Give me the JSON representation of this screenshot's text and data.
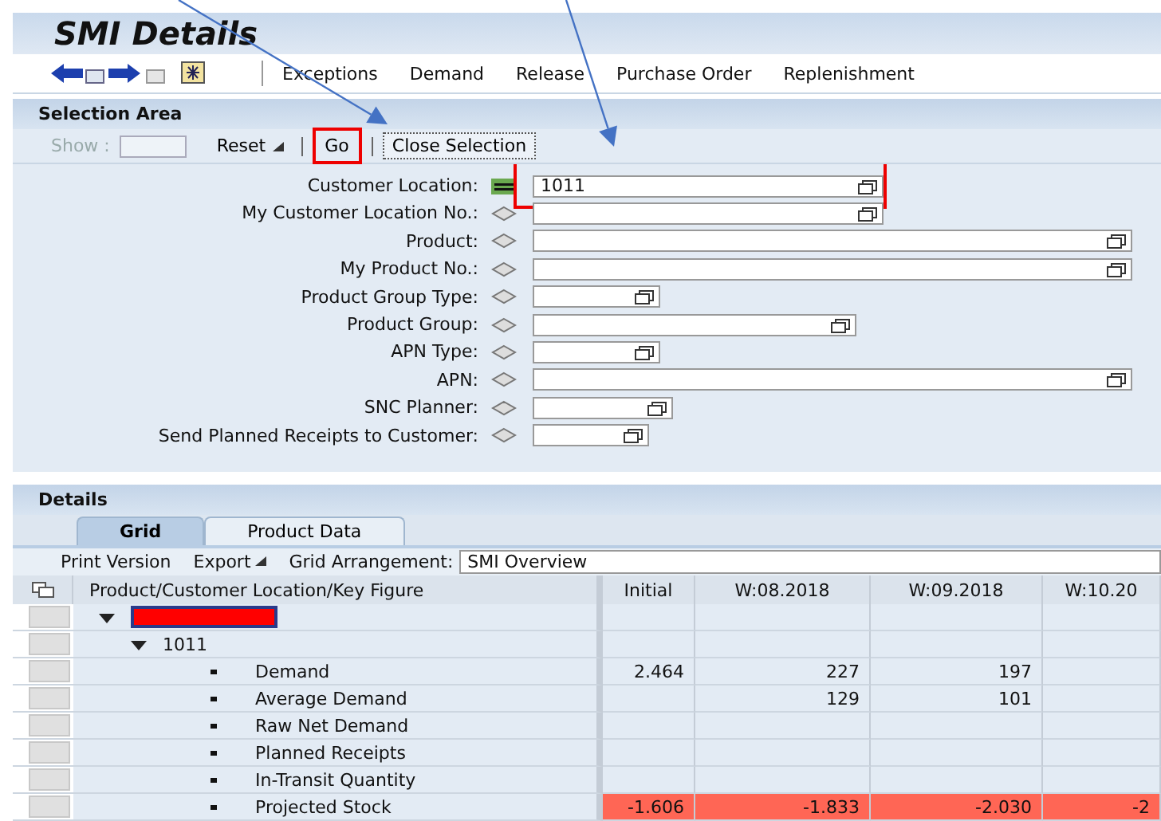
{
  "window": {
    "title": "SMI Details"
  },
  "toolbar": {
    "items": [
      {
        "label": "Exceptions"
      },
      {
        "label": "Demand"
      },
      {
        "label": "Release"
      },
      {
        "label": "Purchase Order"
      },
      {
        "label": "Replenishment"
      }
    ]
  },
  "selection_area": {
    "title": "Selection Area",
    "show_label": "Show :",
    "buttons": [
      {
        "label": "Reset",
        "kind": "menu",
        "highlighted": false
      },
      {
        "label": "Go",
        "kind": "plain",
        "highlighted": true
      },
      {
        "label": "Close Selection",
        "kind": "plain",
        "highlighted": false
      }
    ],
    "fields": [
      {
        "label": "Customer Location:",
        "kind": "equals",
        "value": "1011",
        "highlighted": true
      },
      {
        "label": "My Customer Location No.:",
        "kind": "any",
        "highlighted": false
      },
      {
        "label": "Product:",
        "kind": "any",
        "highlighted": false
      },
      {
        "label": "My Product No.:",
        "kind": "any",
        "highlighted": false
      },
      {
        "label": "Product Group Type:",
        "kind": "any",
        "highlighted": false
      },
      {
        "label": "Product Group:",
        "kind": "any",
        "highlighted": false
      },
      {
        "label": "APN Type:",
        "kind": "any",
        "highlighted": false
      },
      {
        "label": "APN:",
        "kind": "any",
        "highlighted": false
      },
      {
        "label": "SNC Planner:",
        "kind": "any",
        "highlighted": false
      },
      {
        "label": "Send Planned Receipts to Customer:",
        "kind": "any",
        "highlighted": false
      }
    ]
  },
  "details": {
    "title": "Details",
    "tabs": [
      {
        "label": "Grid",
        "selected": true
      },
      {
        "label": "Product Data",
        "selected": false
      }
    ],
    "toolbar": {
      "print": "Print Version",
      "export": "Export",
      "arrangement_label": "Grid Arrangement:",
      "arrangement_value": "SMI Overview"
    },
    "table": {
      "columns": [
        "Product/Customer Location/Key Figure",
        "Initial",
        "W:08.2018",
        "W:09.2018",
        "W:10.20"
      ],
      "rows": [
        {
          "kind": "redacted",
          "expanded": true,
          "children": [
            {
              "kind": "group",
              "label": "1011",
              "expanded": true,
              "children": [
                {
                  "kind": "figure",
                  "label": "Demand",
                  "alert": false,
                  "initial": "2.464",
                  "week_08": "227",
                  "week_09": "197"
                },
                {
                  "kind": "figure",
                  "label": "Average Demand",
                  "alert": false,
                  "week_08": "129",
                  "week_09": "101"
                },
                {
                  "kind": "figure",
                  "label": "Raw Net Demand",
                  "alert": false
                },
                {
                  "kind": "figure",
                  "label": "Planned Receipts",
                  "alert": false
                },
                {
                  "kind": "figure",
                  "label": "In-Transit Quantity",
                  "alert": false
                },
                {
                  "kind": "figure",
                  "label": "Projected Stock",
                  "alert": true,
                  "initial": "-1.606",
                  "week_08": "-1.833",
                  "week_09": "-2.030",
                  "week_10": "-2"
                }
              ]
            }
          ]
        }
      ]
    }
  }
}
